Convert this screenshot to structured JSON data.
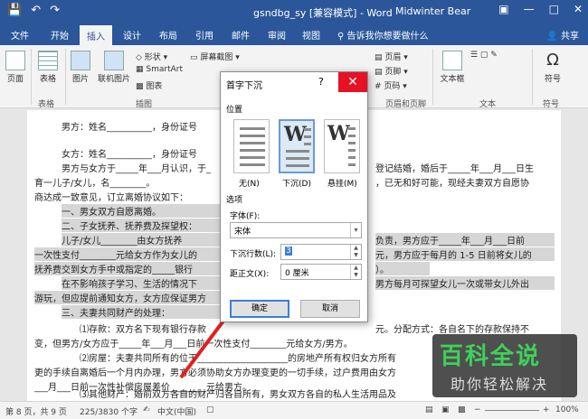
{
  "titlebar": {
    "save_icon": "save-icon",
    "undo_icon": "undo-icon",
    "redo_icon": "redo-icon",
    "title": "gsndbg_sy [兼容模式] - Word",
    "user": "Midwinter Bear"
  },
  "tabs": [
    "文件",
    "开始",
    "插入",
    "设计",
    "布局",
    "引用",
    "邮件",
    "审阅",
    "视图"
  ],
  "active_tab": "插入",
  "tellme": "告诉我你想要做什么",
  "share": "共享",
  "ribbon": {
    "page": "页面",
    "table": "表格",
    "picture": "图片",
    "online_picture": "联机图片",
    "shapes": "形状",
    "smartart": "SmartArt",
    "chart": "图表",
    "screenshot": "屏幕截图",
    "group_tables": "表格",
    "group_illustrations": "插图",
    "header": "页眉",
    "footer": "页脚",
    "page_number": "页码",
    "group_header_footer": "页眉和页脚",
    "textbox": "文本框",
    "symbol": "符号",
    "group_text": "文本",
    "group_symbols": "符号"
  },
  "doc": {
    "l1": "男方：姓名__________，身份证号",
    "l2": "女方：姓名__________，身份证号",
    "l3": "男方与女方于_____年___月认识，于_",
    "l3b": "登记结婚，婚后于_____年___月___日生",
    "l4": "育一儿子/女儿，名________。",
    "l4b": "，已无和好可能，现经夫妻双方自愿协",
    "l5": "商达成一致意见，订立离婚协议如下：",
    "l6": "一、男女双方自愿离婚。",
    "l7": "二、子女抚养、抚养费及探望权：",
    "l8": "儿子/女儿________由女方抚养",
    "l8b": "负责，男方应于_____年___月___日前",
    "l9": "一次性支付________元给女方作为女儿的",
    "l9b": "元，男方应于每月的 1-5 日前将女儿的",
    "l10": "抚养费交到女方手中或指定的_____银行",
    "l10b": "）。",
    "l11": "在不影响孩子学习、生活的情况下",
    "l11b": "男方每月可探望女儿一次或带女儿外出",
    "l12": "游玩，但应提前通知女方，女方应保证男方",
    "l13": "三、夫妻共同财产的处理：",
    "l14": "⑴存款：双方名下现有银行存款",
    "l14b": "元。分配方式：各自名下的存款保持不",
    "l15": "变，但男方/女方应于_____年___月___日前一次性支付________元给女方/男方。",
    "l16": "⑵房屋：夫妻共同所有的位于____________________的房地产所有权归女方所有",
    "l17": "更的手续自离婚后一个月内办理，男方必须协助女方办理变更的一切手续，过户费用由女方",
    "l18": "___月___日前一次性补偿房屋差价________元给男方。",
    "l19": "⑶其他财产：婚前双方各自的财产归各自所有，男女双方各自的私人生活用品及",
    "l20": "______"
  },
  "dialog": {
    "title": "首字下沉",
    "help": "?",
    "close": "✕",
    "position_label": "位置",
    "opt_none": "无(N)",
    "opt_dropped": "下沉(D)",
    "opt_margin": "悬挂(M)",
    "glyph": "W",
    "options_label": "选项",
    "font_label": "字体(F):",
    "font_value": "宋体",
    "lines_label": "下沉行数(L):",
    "lines_value": "3",
    "distance_label": "距正文(X):",
    "distance_value": "0 厘米",
    "ok": "确定",
    "cancel": "取消"
  },
  "status": {
    "page": "第 8 页，共 9 页",
    "words": "225/3830 个字",
    "lang": "中文(中国)",
    "zoom": "100%"
  },
  "watermark": {
    "line1": "百科全说",
    "line2": "助你轻松解决"
  }
}
